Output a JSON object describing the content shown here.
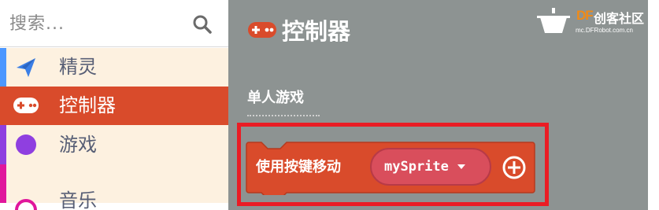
{
  "search": {
    "placeholder": "搜索..."
  },
  "categories": [
    {
      "label": "精灵",
      "icon": "paper-plane-icon",
      "color": "#4c97ff"
    },
    {
      "label": "控制器",
      "icon": "gamepad-icon",
      "color": "#d94b2b",
      "selected": true
    },
    {
      "label": "游戏",
      "icon": "circle-icon",
      "color": "#8f3fe0"
    },
    {
      "label": "音乐",
      "icon": "headphones-icon",
      "color": "#e0179c"
    }
  ],
  "flyout": {
    "title": "控制器",
    "section": "单人游戏",
    "block": {
      "text": "使用按键移动",
      "sprite": "mySprite",
      "color": "#d94b2b"
    }
  },
  "logo": {
    "brand": "DF",
    "name": "创客社区",
    "url": "mc.DFRobot.com.cn"
  },
  "colors": {
    "highlight": "#ea1c24",
    "workspace": "#8d9392",
    "category_bg": "#fdf1e0"
  }
}
